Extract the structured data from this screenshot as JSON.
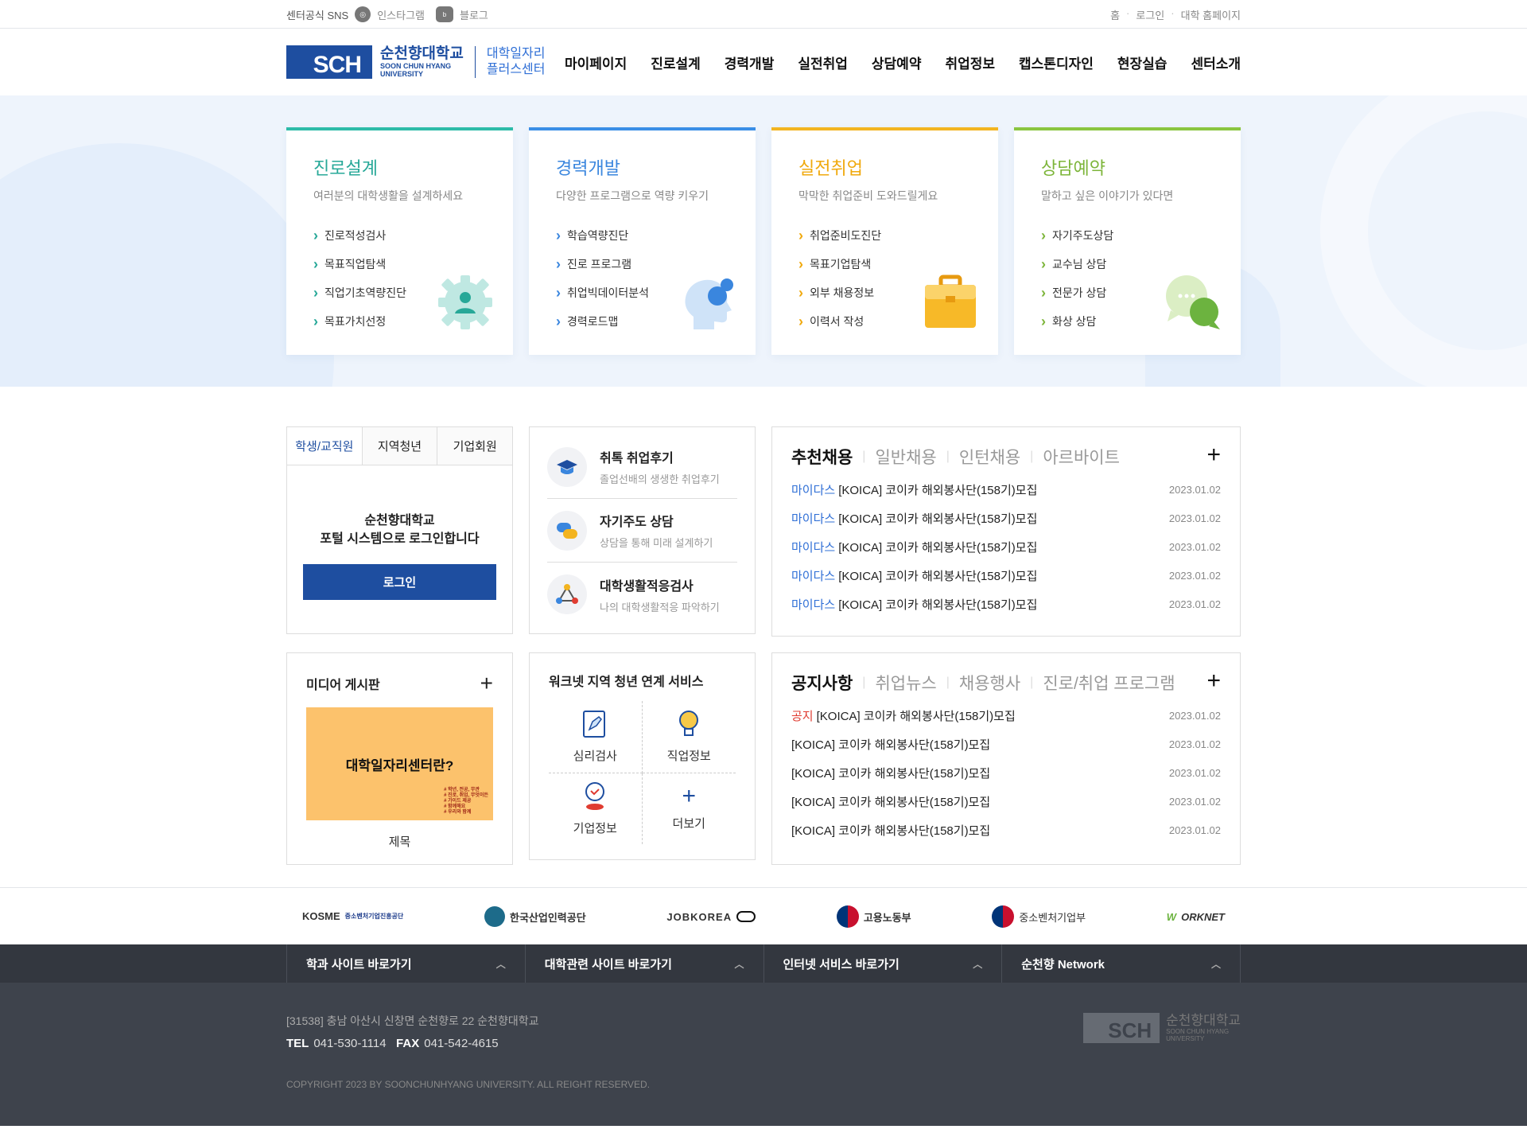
{
  "topbar": {
    "sns_label": "센터공식 SNS",
    "instagram": "인스타그램",
    "blog": "블로그",
    "util": [
      "홈",
      "로그인",
      "대학 홈페이지"
    ]
  },
  "header": {
    "logo_mark": "SCH",
    "logo_kname": "순천향대학교",
    "logo_ename_1": "SOON CHUN HYANG",
    "logo_ename_2": "UNIVERSITY",
    "center_1": "대학일자리",
    "center_2": "플러스센터",
    "nav": [
      "마이페이지",
      "진로설계",
      "경력개발",
      "실전취업",
      "상담예약",
      "취업정보",
      "캡스톤디자인",
      "현장실습",
      "센터소개"
    ]
  },
  "cards": [
    {
      "title": "진로설계",
      "sub": "여러분의 대학생활을 설계하세요",
      "items": [
        "진로적성검사",
        "목표직업탐색",
        "직업기초역량진단",
        "목표가치선정"
      ],
      "icon": "gear-person-icon"
    },
    {
      "title": "경력개발",
      "sub": "다양한 프로그램으로 역량 키우기",
      "items": [
        "학습역량진단",
        "진로 프로그램",
        "취업빅데이터분석",
        "경력로드맵"
      ],
      "icon": "head-idea-icon"
    },
    {
      "title": "실전취업",
      "sub": "막막한 취업준비 도와드릴게요",
      "items": [
        "취업준비도진단",
        "목표기업탐색",
        "외부 채용정보",
        "이력서 작성"
      ],
      "icon": "briefcase-icon"
    },
    {
      "title": "상담예약",
      "sub": "말하고 싶은 이야기가 있다면",
      "items": [
        "자기주도상담",
        "교수님 상담",
        "전문가 상담",
        "화상 상담"
      ],
      "icon": "chat-bubbles-icon"
    }
  ],
  "login": {
    "tabs": [
      "학생/교직원",
      "지역청년",
      "기업회원"
    ],
    "msg_1": "순천향대학교",
    "msg_2": "포털 시스템으로 로그인합니다",
    "button": "로그인"
  },
  "quick": [
    {
      "title": "취톡 취업후기",
      "desc": "졸업선배의 생생한 취업후기",
      "icon": "graduation-cap-icon"
    },
    {
      "title": "자기주도 상담",
      "desc": "상담을 통해 미래 설계하기",
      "icon": "speech-bubbles-icon"
    },
    {
      "title": "대학생활적응검사",
      "desc": "나의 대학생활적응 파악하기",
      "icon": "network-nodes-icon"
    }
  ],
  "recruit": {
    "tabs": [
      "추천채용",
      "일반채용",
      "인턴채용",
      "아르바이트"
    ],
    "items": [
      {
        "tag": "마이다스",
        "title": "[KOICA] 코이카 해외봉사단(158기)모집",
        "date": "2023.01.02"
      },
      {
        "tag": "마이다스",
        "title": "[KOICA] 코이카 해외봉사단(158기)모집",
        "date": "2023.01.02"
      },
      {
        "tag": "마이다스",
        "title": "[KOICA] 코이카 해외봉사단(158기)모집",
        "date": "2023.01.02"
      },
      {
        "tag": "마이다스",
        "title": "[KOICA] 코이카 해외봉사단(158기)모집",
        "date": "2023.01.02"
      },
      {
        "tag": "마이다스",
        "title": "[KOICA] 코이카 해외봉사단(158기)모집",
        "date": "2023.01.02"
      }
    ]
  },
  "media": {
    "title": "미디어 게시판",
    "thumb_text": "대학일자리센터란?",
    "thumb_note": [
      "# 학년, 전공, 무관",
      "# 진로, 취업, 무엇이든",
      "# 가이드 제공",
      "# 함께해요",
      "# 우리와 함께"
    ],
    "caption": "제목"
  },
  "worknet": {
    "title": "워크넷 지역 청년 연계 서비스",
    "items": [
      {
        "label": "심리검사",
        "icon": "clipboard-pencil-icon"
      },
      {
        "label": "직업정보",
        "icon": "lightbulb-icon"
      },
      {
        "label": "기업정보",
        "icon": "location-person-icon"
      },
      {
        "label": "더보기",
        "icon": "plus-icon"
      }
    ]
  },
  "notice": {
    "tabs": [
      "공지사항",
      "취업뉴스",
      "채용행사",
      "진로/취업 프로그램"
    ],
    "items": [
      {
        "tag": "공지",
        "title": "[KOICA] 코이카 해외봉사단(158기)모집",
        "date": "2023.01.02"
      },
      {
        "tag": "",
        "title": "[KOICA] 코이카 해외봉사단(158기)모집",
        "date": "2023.01.02"
      },
      {
        "tag": "",
        "title": "[KOICA] 코이카 해외봉사단(158기)모집",
        "date": "2023.01.02"
      },
      {
        "tag": "",
        "title": "[KOICA] 코이카 해외봉사단(158기)모집",
        "date": "2023.01.02"
      },
      {
        "tag": "",
        "title": "[KOICA] 코이카 해외봉사단(158기)모집",
        "date": "2023.01.02"
      }
    ]
  },
  "partners": {
    "kosme": "KOSME",
    "kosme_sub": "중소벤처기업진흥공단",
    "hrd": "한국산업인력공단",
    "jobkorea": "JOBKOREA",
    "moel": "고용노동부",
    "mss": "중소벤처기업부",
    "worknet_w": "W",
    "worknet_rest": "ORKNET"
  },
  "footer_nav": [
    "학과 사이트 바로가기",
    "대학관련 사이트 바로가기",
    "인터넷 서비스 바로가기",
    "순천향 Network"
  ],
  "footer": {
    "address": "[31538] 충남 아산시 신창면 순천향로 22 순천향대학교",
    "tel_label": "TEL",
    "tel": "041-530-1114",
    "fax_label": "FAX",
    "fax": "041-542-4615",
    "copyright": "COPYRIGHT 2023 BY SOONCHUNHYANG UNIVERSITY. ALL REIGHT RESERVED.",
    "logo_mark": "SCH",
    "logo_kname": "순천향대학교",
    "logo_ename_1": "SOON CHUN HYANG",
    "logo_ename_2": "UNIVERSITY"
  },
  "colors": {
    "brand": "#1e4ea0",
    "teal": "#27a898",
    "blue": "#3a86de",
    "yellow": "#f0a90c",
    "green": "#7db53a"
  }
}
